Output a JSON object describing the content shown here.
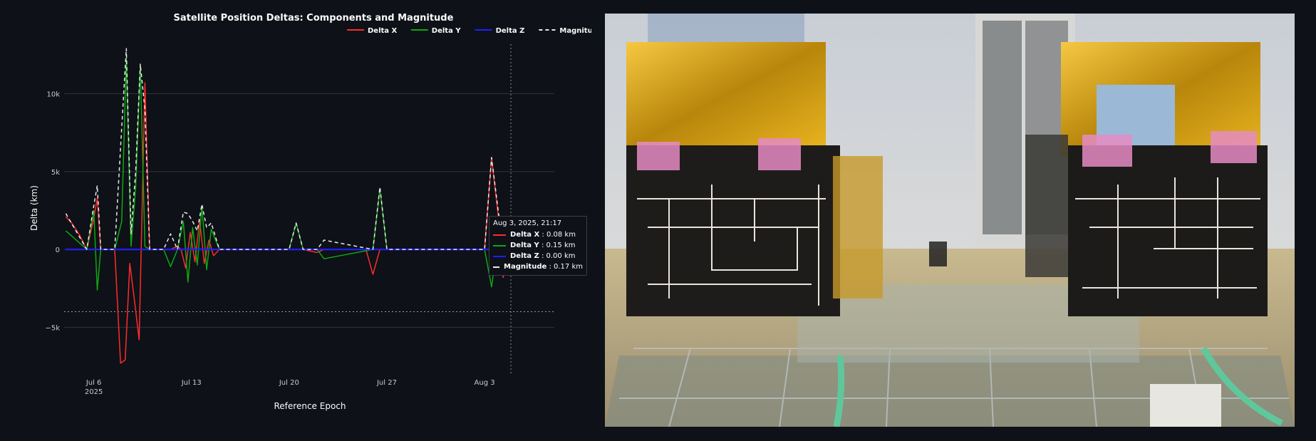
{
  "chart_data": {
    "type": "line",
    "title": "Satellite Position Deltas: Components and Magnitude",
    "xlabel": "Reference Epoch",
    "ylabel": "Delta (km)",
    "x_ticks": [
      {
        "date": "2025-07-06",
        "label": "Jul 6",
        "sub": "2025"
      },
      {
        "date": "2025-07-13",
        "label": "Jul 13",
        "sub": ""
      },
      {
        "date": "2025-07-20",
        "label": "Jul 20",
        "sub": ""
      },
      {
        "date": "2025-07-27",
        "label": "Jul 27",
        "sub": ""
      },
      {
        "date": "2025-08-03",
        "label": "Aug 3",
        "sub": ""
      }
    ],
    "y_ticks": [
      {
        "value": 10000,
        "label": "10k"
      },
      {
        "value": 5000,
        "label": "5k"
      },
      {
        "value": 0,
        "label": "0"
      },
      {
        "value": -5000,
        "label": "−5k"
      }
    ],
    "xlim": [
      "2025-07-03T21:00",
      "2025-08-08T00:00"
    ],
    "ylim": [
      -8000,
      13500
    ],
    "grid": true,
    "legend_position": "top-right",
    "reference_line_y": -4000,
    "hover_date": "2025-08-04T21:17",
    "series": [
      {
        "name": "Delta X",
        "color": "#ff2b2b",
        "dash": "solid",
        "x": [
          "2025-07-04T00:00",
          "2025-07-04T10:00",
          "2025-07-05T00:00",
          "2025-07-05T12:00",
          "2025-07-06T00:00",
          "2025-07-06T06:00",
          "2025-07-06T12:00",
          "2025-07-07T12:00",
          "2025-07-07T22:00",
          "2025-07-08T06:00",
          "2025-07-08T14:00",
          "2025-07-08T22:00",
          "2025-07-09T06:00",
          "2025-07-09T16:00",
          "2025-07-10T00:00",
          "2025-07-10T12:00",
          "2025-07-11T00:00",
          "2025-07-11T12:00",
          "2025-07-12T00:00",
          "2025-07-12T06:00",
          "2025-07-12T14:00",
          "2025-07-12T22:00",
          "2025-07-13T06:00",
          "2025-07-13T14:00",
          "2025-07-13T22:00",
          "2025-07-14T06:00",
          "2025-07-14T14:00",
          "2025-07-15T00:00",
          "2025-07-20T00:00",
          "2025-07-21T00:00",
          "2025-07-22T00:00",
          "2025-07-22T12:00",
          "2025-07-24T00:00",
          "2025-07-25T12:00",
          "2025-07-26T00:00",
          "2025-07-26T12:00",
          "2025-08-03T00:00",
          "2025-08-03T12:00",
          "2025-08-04T00:00",
          "2025-08-04T08:00",
          "2025-08-04T16:00",
          "2025-08-04T21:17"
        ],
        "y": [
          2100,
          1700,
          900,
          0,
          2000,
          3300,
          0,
          0,
          -7300,
          -7100,
          -900,
          -3300,
          -5800,
          10700,
          0,
          0,
          0,
          0,
          200,
          0,
          -1200,
          1100,
          -800,
          1900,
          -900,
          600,
          -400,
          0,
          0,
          0,
          -200,
          0,
          0,
          0,
          -1600,
          0,
          0,
          5900,
          2000,
          -1800,
          0,
          80
        ]
      },
      {
        "name": "Delta Y",
        "color": "#0ea812",
        "dash": "solid",
        "x": [
          "2025-07-04T00:00",
          "2025-07-05T12:00",
          "2025-07-06T00:00",
          "2025-07-06T06:00",
          "2025-07-06T12:00",
          "2025-07-07T12:00",
          "2025-07-08T00:00",
          "2025-07-08T08:00",
          "2025-07-08T16:00",
          "2025-07-09T00:00",
          "2025-07-09T08:00",
          "2025-07-09T16:00",
          "2025-07-10T00:00",
          "2025-07-11T00:00",
          "2025-07-11T12:00",
          "2025-07-12T00:00",
          "2025-07-12T10:00",
          "2025-07-12T18:00",
          "2025-07-13T02:00",
          "2025-07-13T10:00",
          "2025-07-13T18:00",
          "2025-07-14T02:00",
          "2025-07-14T10:00",
          "2025-07-15T00:00",
          "2025-07-20T00:00",
          "2025-07-20T12:00",
          "2025-07-21T00:00",
          "2025-07-22T00:00",
          "2025-07-22T12:00",
          "2025-07-26T00:00",
          "2025-07-26T12:00",
          "2025-07-27T00:00",
          "2025-08-03T00:00",
          "2025-08-03T12:00",
          "2025-08-04T00:00",
          "2025-08-04T12:00",
          "2025-08-04T21:17"
        ],
        "y": [
          1200,
          0,
          2500,
          -2600,
          0,
          0,
          1800,
          12300,
          200,
          4000,
          11800,
          200,
          0,
          0,
          -1100,
          0,
          1800,
          -2100,
          1400,
          -1000,
          2800,
          -1300,
          1300,
          0,
          0,
          1700,
          0,
          0,
          -600,
          0,
          3900,
          0,
          0,
          -2400,
          700,
          0,
          150
        ]
      },
      {
        "name": "Delta Z",
        "color": "#1f1fff",
        "dash": "solid",
        "x": [
          "2025-07-04T00:00",
          "2025-08-04T21:17"
        ],
        "y": [
          0,
          0
        ]
      },
      {
        "name": "Magnitude",
        "color": "#e8e8e8",
        "dash": "dashed",
        "x": [
          "2025-07-04T00:00",
          "2025-07-05T12:00",
          "2025-07-06T00:00",
          "2025-07-06T06:00",
          "2025-07-06T12:00",
          "2025-07-07T12:00",
          "2025-07-08T00:00",
          "2025-07-08T08:00",
          "2025-07-08T16:00",
          "2025-07-09T00:00",
          "2025-07-09T08:00",
          "2025-07-09T16:00",
          "2025-07-10T00:00",
          "2025-07-11T00:00",
          "2025-07-11T12:00",
          "2025-07-12T00:00",
          "2025-07-12T10:00",
          "2025-07-12T18:00",
          "2025-07-13T02:00",
          "2025-07-13T10:00",
          "2025-07-13T18:00",
          "2025-07-14T02:00",
          "2025-07-14T10:00",
          "2025-07-15T00:00",
          "2025-07-20T00:00",
          "2025-07-20T12:00",
          "2025-07-21T00:00",
          "2025-07-22T00:00",
          "2025-07-22T12:00",
          "2025-07-26T00:00",
          "2025-07-26T12:00",
          "2025-07-27T00:00",
          "2025-08-03T00:00",
          "2025-08-03T12:00",
          "2025-08-04T00:00",
          "2025-08-04T12:00",
          "2025-08-04T21:17"
        ],
        "y": [
          2300,
          0,
          2800,
          4100,
          0,
          0,
          7800,
          12900,
          1000,
          5000,
          11900,
          9000,
          0,
          0,
          1000,
          0,
          2400,
          2300,
          1800,
          1200,
          2900,
          1400,
          1700,
          0,
          0,
          1700,
          0,
          0,
          600,
          0,
          4000,
          0,
          0,
          5900,
          2300,
          0,
          170
        ]
      }
    ]
  },
  "tooltip": {
    "header": "Aug 3, 2025, 21:17",
    "rows": [
      {
        "name": "Delta X",
        "value": "0.08 km",
        "color": "#ff2b2b",
        "dash": "solid"
      },
      {
        "name": "Delta Y",
        "value": "0.15 km",
        "color": "#0ea812",
        "dash": "solid"
      },
      {
        "name": "Delta Z",
        "value": "0.00 km",
        "color": "#1f1fff",
        "dash": "solid"
      },
      {
        "name": "Magnitude",
        "value": "0.17 km",
        "color": "#e8e8e8",
        "dash": "dashed"
      }
    ]
  },
  "colors": {
    "background": "#0e1117",
    "grid": "#2e333d",
    "text": "#fafafa",
    "axis_text": "#c9cbd0"
  }
}
